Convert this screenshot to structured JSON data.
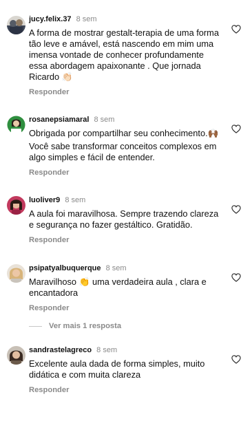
{
  "comments": [
    {
      "username": "jucy.felix.37",
      "time": "8 sem",
      "text": "A forma de mostrar gestalt-terapia de uma forma tão leve e amável, está nascendo em mim uma imensa vontade de conhecer profundamente essa abordagem apaixonante . Que jornada Ricardo 👏🏻",
      "reply": "Responder",
      "avatar_color": "#6b6f7a"
    },
    {
      "username": "rosanepsiamaral",
      "time": "8 sem",
      "text": "Obrigada por compartilhar seu conhecimento.🙌🏾",
      "text2": "Você sabe transformar conceitos complexos em algo simples e fácil de entender.",
      "reply": "Responder",
      "avatar_color": "#3a9a4a"
    },
    {
      "username": "luoliver9",
      "time": "8 sem",
      "text": "A aula foi maravilhosa. Sempre trazendo clareza e segurança no fazer gestáltico. Gratidão.",
      "reply": "Responder",
      "avatar_color": "#b53355"
    },
    {
      "username": "psipatyalbuquerque",
      "time": "8 sem",
      "text": "Maravilhoso 👏 uma verdadeira aula , clara e encantadora",
      "reply": "Responder",
      "avatar_color": "#c9a98a"
    },
    {
      "username": "sandrastelagreco",
      "time": "8 sem",
      "text": "Excelente  aula  dada de forma simples, muito didática  e com muita  clareza",
      "reply": "Responder",
      "avatar_color": "#8a7a6a"
    }
  ],
  "view_more_replies": "Ver mais 1 resposta",
  "icons": {
    "like": "heart-outline-icon"
  }
}
